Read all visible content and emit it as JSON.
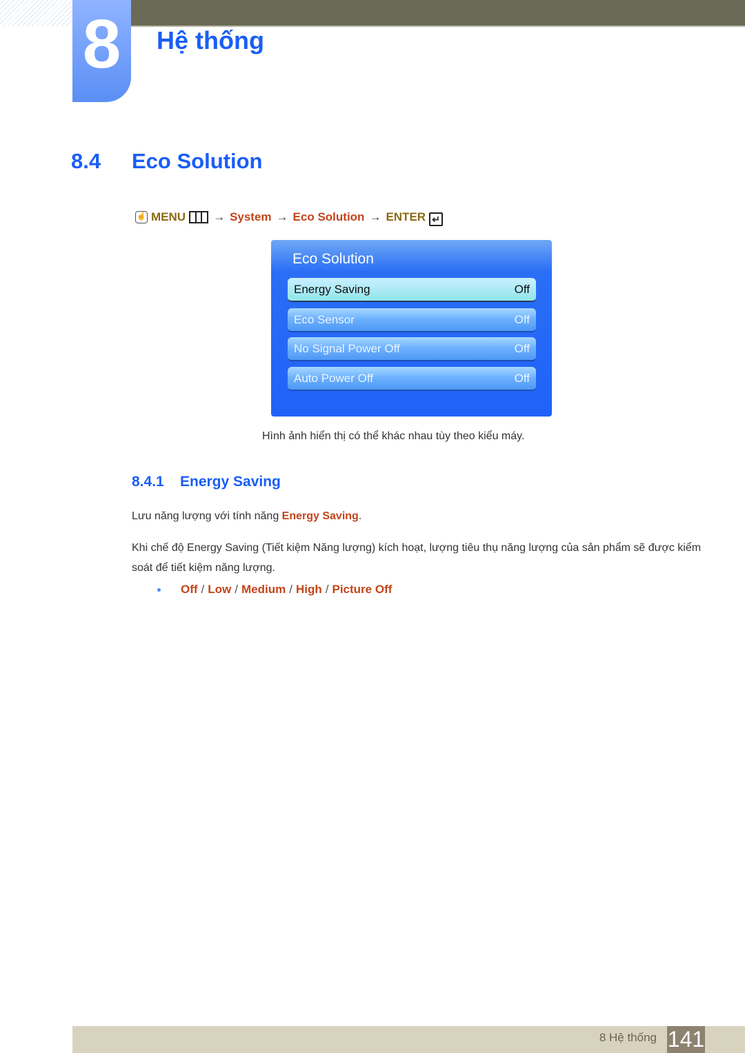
{
  "chapter": {
    "number": "8",
    "title": "Hệ thống"
  },
  "section": {
    "number": "8.4",
    "title": "Eco Solution"
  },
  "nav_path": {
    "icon": "remote-hand-icon",
    "menu": "MENU",
    "arrow": "→",
    "system": "System",
    "eco": "Eco Solution",
    "enter": "ENTER"
  },
  "osd": {
    "title": "Eco Solution",
    "items": [
      {
        "label": "Energy Saving",
        "value": "Off",
        "selected": true
      },
      {
        "label": "Eco Sensor",
        "value": "Off"
      },
      {
        "label": "No Signal Power Off",
        "value": "Off"
      },
      {
        "label": "Auto Power Off",
        "value": "Off"
      }
    ]
  },
  "caption": "Hình ảnh hiển thị có thể khác nhau tùy theo kiểu máy.",
  "subsection": {
    "number": "8.4.1",
    "title": "Energy Saving"
  },
  "para1": {
    "text": "Lưu năng lượng với tính năng ",
    "highlight": "Energy Saving",
    "end": "."
  },
  "para2": "Khi chế độ Energy Saving (Tiết kiệm Năng lượng) kích hoạt, lượng tiêu thụ năng lượng của sản phẩm sẽ được kiểm soát để tiết kiệm năng lượng.",
  "options": {
    "items": [
      "Off",
      "Low",
      "Medium",
      "High",
      "Picture Off"
    ],
    "separator": "/"
  },
  "footer": {
    "chapter": "8 Hệ thống",
    "page": "141"
  },
  "colors": {
    "heading": "#1a5ef5",
    "highlight": "#c4441a",
    "topbar": "#6b6a56",
    "footer": "#d8d3bf"
  }
}
